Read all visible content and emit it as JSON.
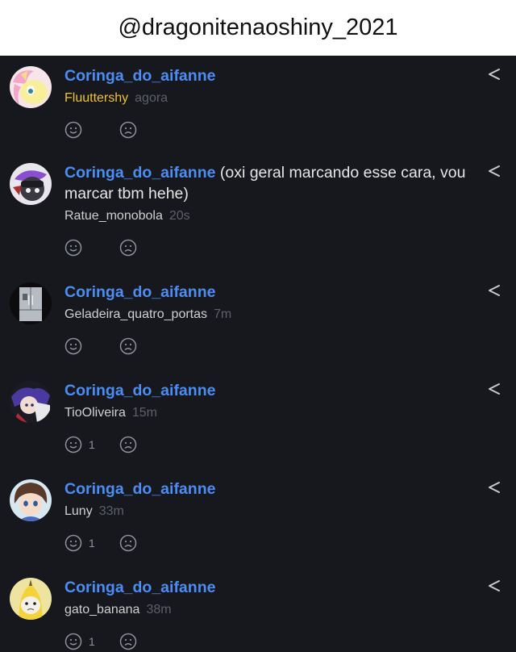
{
  "header": {
    "title": "@dragonitenaoshiny_2021"
  },
  "icons": {
    "like": "smile-icon",
    "dislike": "frown-icon",
    "reply": "reply-arrow-icon"
  },
  "colors": {
    "mention": "#4b8df2",
    "background": "#16181d",
    "highlighted_author": "#f2c230"
  },
  "comments": [
    {
      "mention": "Coringa_do_aifanne",
      "text": "",
      "author": "Fluuttershy",
      "time": "agora",
      "likes": "",
      "avatar": "pony-avatar"
    },
    {
      "mention": "Coringa_do_aifanne",
      "text": " (oxi geral marcando esse cara, vou marcar tbm hehe)",
      "author": "Ratue_monobola",
      "time": "20s",
      "likes": "",
      "avatar": "character-avatar"
    },
    {
      "mention": "Coringa_do_aifanne",
      "text": "",
      "author": "Geladeira_quatro_portas",
      "time": "7m",
      "likes": "",
      "avatar": "refrigerator-avatar"
    },
    {
      "mention": "Coringa_do_aifanne",
      "text": "",
      "author": "TioOliveira",
      "time": "15m",
      "likes": "1",
      "avatar": "anime-avatar"
    },
    {
      "mention": "Coringa_do_aifanne",
      "text": "",
      "author": "Luny",
      "time": "33m",
      "likes": "1",
      "avatar": "anime-girl-avatar"
    },
    {
      "mention": "Coringa_do_aifanne",
      "text": "",
      "author": "gato_banana",
      "time": "38m",
      "likes": "1",
      "avatar": "banana-cat-avatar"
    }
  ]
}
